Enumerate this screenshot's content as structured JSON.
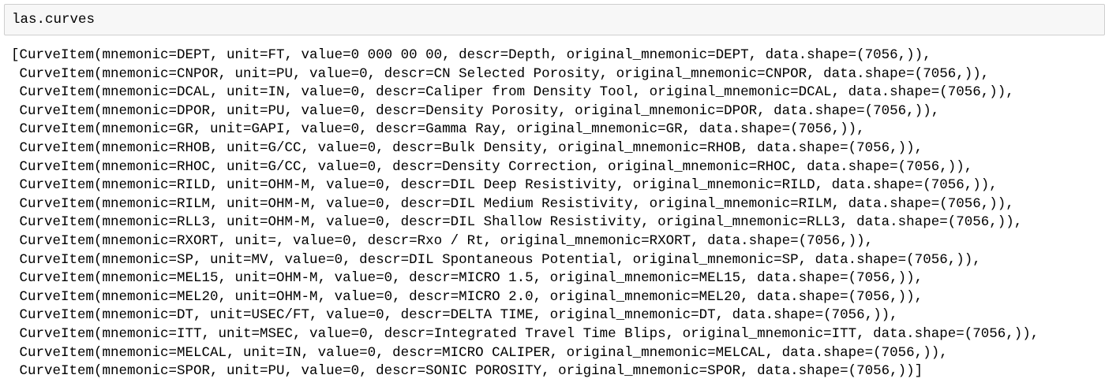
{
  "input_cell": {
    "code": "las.curves"
  },
  "output": {
    "lines": [
      "[CurveItem(mnemonic=DEPT, unit=FT, value=0 000 00 00, descr=Depth, original_mnemonic=DEPT, data.shape=(7056,)),",
      " CurveItem(mnemonic=CNPOR, unit=PU, value=0, descr=CN Selected Porosity, original_mnemonic=CNPOR, data.shape=(7056,)),",
      " CurveItem(mnemonic=DCAL, unit=IN, value=0, descr=Caliper from Density Tool, original_mnemonic=DCAL, data.shape=(7056,)),",
      " CurveItem(mnemonic=DPOR, unit=PU, value=0, descr=Density Porosity, original_mnemonic=DPOR, data.shape=(7056,)),",
      " CurveItem(mnemonic=GR, unit=GAPI, value=0, descr=Gamma Ray, original_mnemonic=GR, data.shape=(7056,)),",
      " CurveItem(mnemonic=RHOB, unit=G/CC, value=0, descr=Bulk Density, original_mnemonic=RHOB, data.shape=(7056,)),",
      " CurveItem(mnemonic=RHOC, unit=G/CC, value=0, descr=Density Correction, original_mnemonic=RHOC, data.shape=(7056,)),",
      " CurveItem(mnemonic=RILD, unit=OHM-M, value=0, descr=DIL Deep Resistivity, original_mnemonic=RILD, data.shape=(7056,)),",
      " CurveItem(mnemonic=RILM, unit=OHM-M, value=0, descr=DIL Medium Resistivity, original_mnemonic=RILM, data.shape=(7056,)),",
      " CurveItem(mnemonic=RLL3, unit=OHM-M, value=0, descr=DIL Shallow Resistivity, original_mnemonic=RLL3, data.shape=(7056,)),",
      " CurveItem(mnemonic=RXORT, unit=, value=0, descr=Rxo / Rt, original_mnemonic=RXORT, data.shape=(7056,)),",
      " CurveItem(mnemonic=SP, unit=MV, value=0, descr=DIL Spontaneous Potential, original_mnemonic=SP, data.shape=(7056,)),",
      " CurveItem(mnemonic=MEL15, unit=OHM-M, value=0, descr=MICRO 1.5, original_mnemonic=MEL15, data.shape=(7056,)),",
      " CurveItem(mnemonic=MEL20, unit=OHM-M, value=0, descr=MICRO 2.0, original_mnemonic=MEL20, data.shape=(7056,)),",
      " CurveItem(mnemonic=DT, unit=USEC/FT, value=0, descr=DELTA TIME, original_mnemonic=DT, data.shape=(7056,)),",
      " CurveItem(mnemonic=ITT, unit=MSEC, value=0, descr=Integrated Travel Time Blips, original_mnemonic=ITT, data.shape=(7056,)),",
      " CurveItem(mnemonic=MELCAL, unit=IN, value=0, descr=MICRO CALIPER, original_mnemonic=MELCAL, data.shape=(7056,)),",
      " CurveItem(mnemonic=SPOR, unit=PU, value=0, descr=SONIC POROSITY, original_mnemonic=SPOR, data.shape=(7056,))]"
    ]
  },
  "colors": {
    "input_background": "#f7f7f7",
    "input_border": "#cfcfcf",
    "text": "#000000",
    "page_background": "#ffffff"
  }
}
